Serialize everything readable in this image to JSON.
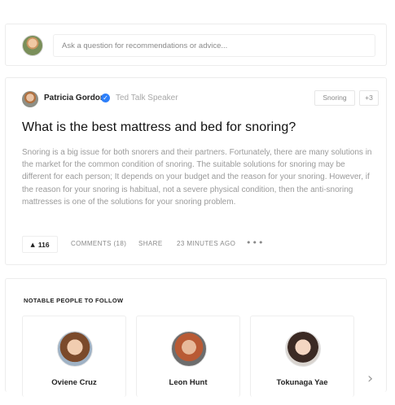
{
  "ask": {
    "placeholder": "Ask a question for recommendations or advice..."
  },
  "question": {
    "author_name": "Patricia Gordon",
    "author_title": "Ted Talk Speaker",
    "tag": "Snoring",
    "more_tags": "+3",
    "title": "What is the best mattress and bed for snoring?",
    "body": "Snoring is a big issue for both snorers and their partners. Fortunately, there are many solutions in the market for the common condition of snoring. The suitable solutions for snoring may be different for each person; It depends on your budget and the reason for your snoring. However, if the reason for your snoring is habitual, not a severe physical condition, then the anti-snoring mattresses is one of the solutions for your snoring problem.",
    "votes": "116",
    "comments_label": "COMMENTS (18)",
    "share_label": "SHARE",
    "timestamp": "23 MINUTES AGO",
    "more_label": "•••"
  },
  "people": {
    "heading": "NOTABLE PEOPLE TO FOLLOW",
    "items": [
      {
        "name": "Oviene Cruz"
      },
      {
        "name": "Leon Hunt"
      },
      {
        "name": "Tokunaga Yae"
      }
    ]
  },
  "icons": {
    "verified": "verified-check-icon",
    "upvote": "arrow-up-icon",
    "next": "chevron-right-icon"
  },
  "colors": {
    "verified": "#2d7ff9"
  }
}
